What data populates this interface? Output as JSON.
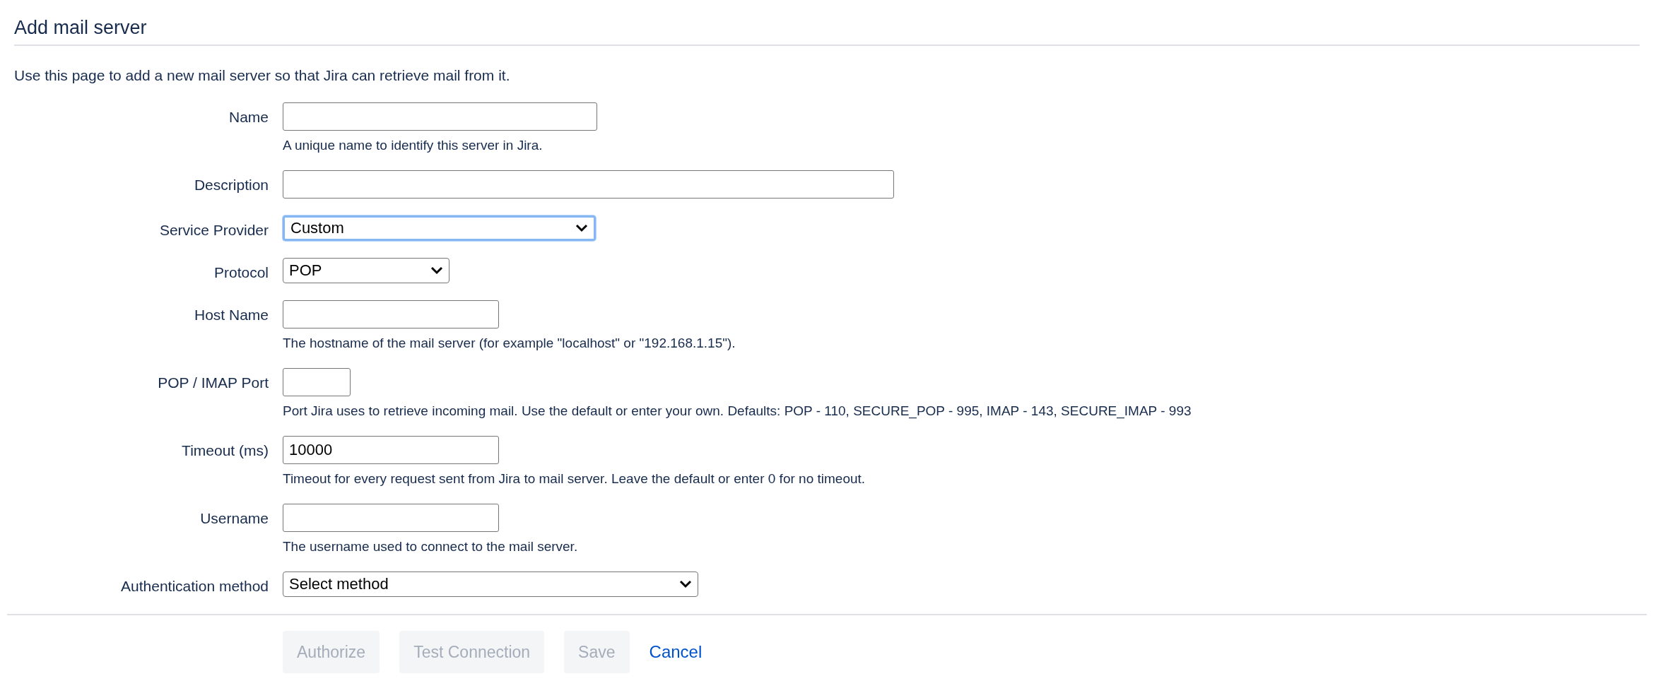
{
  "page": {
    "title": "Add mail server",
    "intro": "Use this page to add a new mail server so that Jira can retrieve mail from it."
  },
  "fields": [
    {
      "kind": "text",
      "label": "Name",
      "hint": "A unique name to identify this server in Jira.",
      "focused": false
    },
    {
      "kind": "text",
      "label": "Description",
      "focused": false
    },
    {
      "kind": "select",
      "label": "Service Provider",
      "value": "Custom",
      "focused": true
    },
    {
      "kind": "select",
      "label": "Protocol",
      "value": "POP",
      "focused": false
    },
    {
      "kind": "text",
      "label": "Host Name",
      "hint": "The hostname of the mail server (for example \"localhost\" or \"192.168.1.15\").",
      "focused": false
    },
    {
      "kind": "text",
      "label": "POP / IMAP Port",
      "hint": "Port Jira uses to retrieve incoming mail. Use the default or enter your own. Defaults: POP - 110, SECURE_POP - 995, IMAP - 143, SECURE_IMAP - 993",
      "focused": false
    },
    {
      "kind": "text",
      "label": "Timeout (ms)",
      "value": "10000",
      "hint": "Timeout for every request sent from Jira to mail server. Leave the default or enter 0 for no timeout.",
      "focused": false
    },
    {
      "kind": "text",
      "label": "Username",
      "hint": "The username used to connect to the mail server.",
      "focused": false
    },
    {
      "kind": "select",
      "label": "Authentication method",
      "value": "Select method",
      "focused": false
    }
  ],
  "actions": [
    {
      "kind": "button",
      "label": "Authorize",
      "disabled": true
    },
    {
      "kind": "button",
      "label": "Test Connection",
      "disabled": true
    },
    {
      "kind": "button",
      "label": "Save",
      "disabled": true
    },
    {
      "kind": "link",
      "label": "Cancel",
      "disabled": false
    }
  ]
}
